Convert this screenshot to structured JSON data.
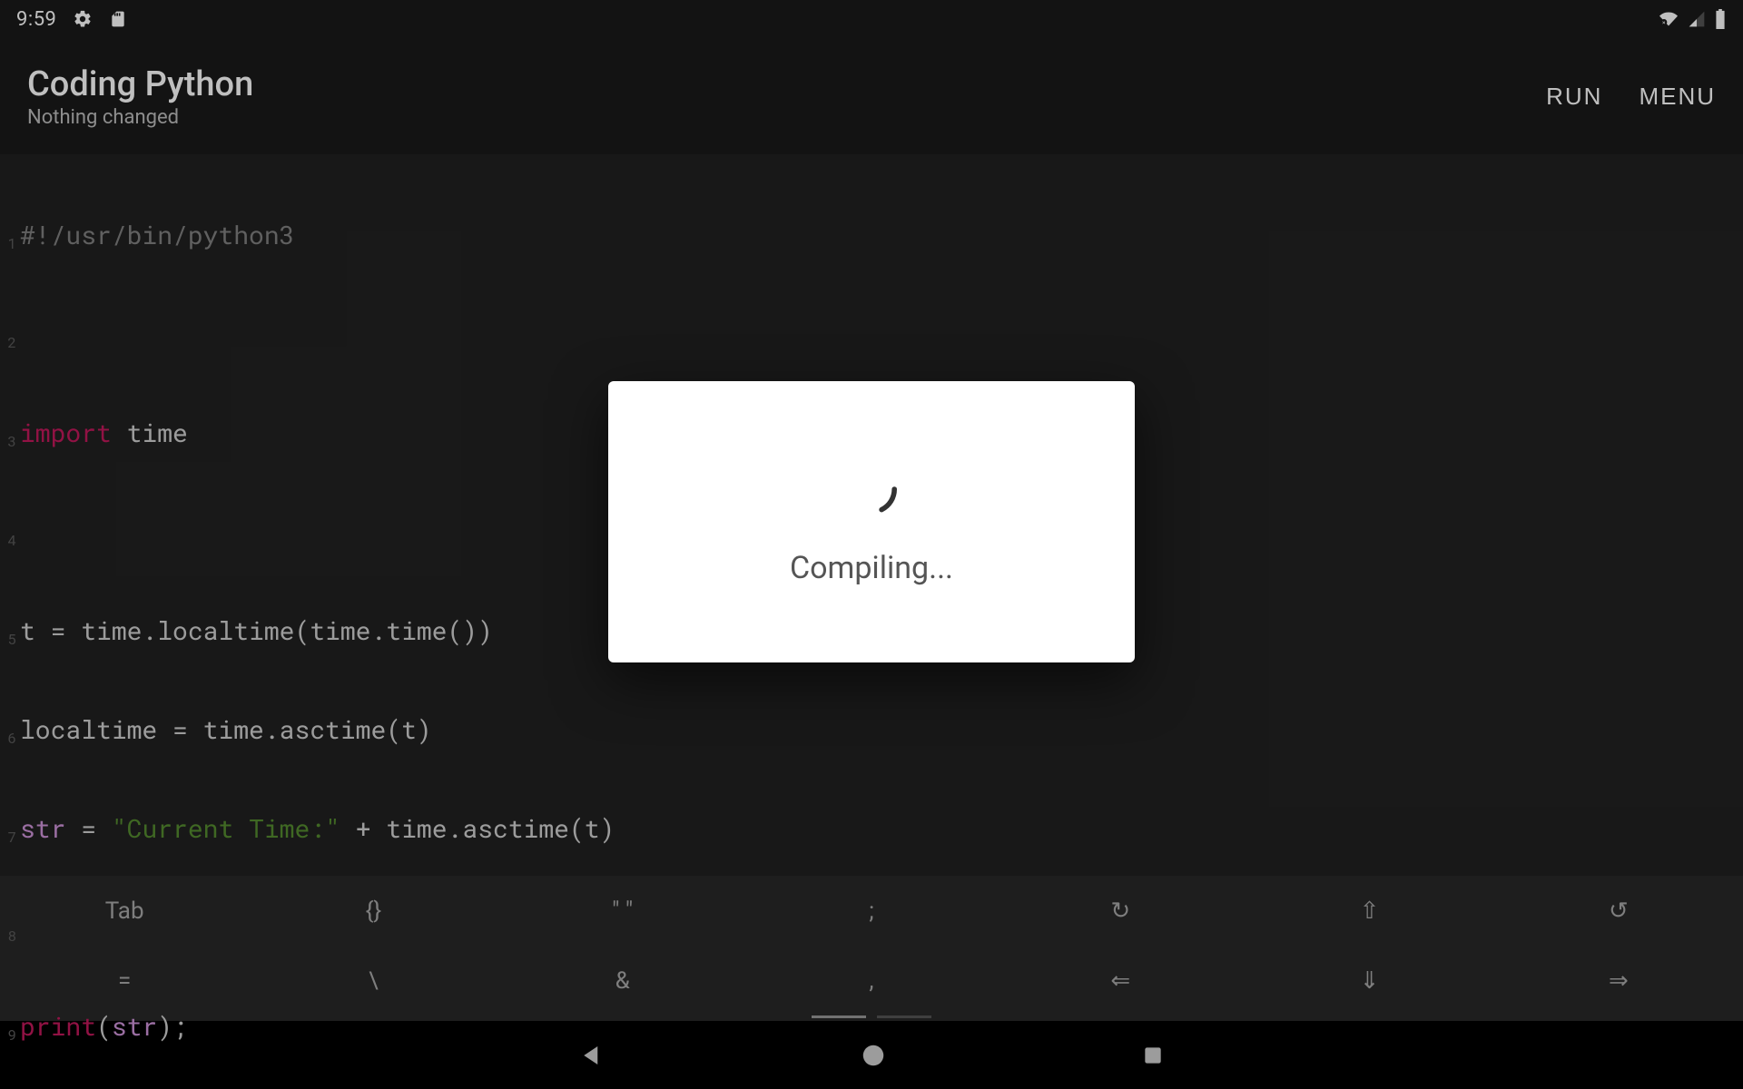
{
  "status": {
    "time": "9:59"
  },
  "toolbar": {
    "title": "Coding Python",
    "subtitle": "Nothing changed",
    "run_label": "RUN",
    "menu_label": "MENU"
  },
  "code": {
    "lines": [
      {
        "n": "1",
        "comment": "#!/usr/bin/python3"
      },
      {
        "n": "2",
        "blank": ""
      },
      {
        "n": "3",
        "kw": "import",
        "rest": " time"
      },
      {
        "n": "4",
        "blank": ""
      },
      {
        "n": "5",
        "plain": "t = time.localtime(time.time())"
      },
      {
        "n": "6",
        "plain": "localtime = time.asctime(t)"
      },
      {
        "n": "7",
        "name": "str",
        "mid": " = ",
        "str": "\"Current Time:\"",
        "rest": " + time.asctime(t)"
      },
      {
        "n": "8",
        "blank": ""
      },
      {
        "n": "9",
        "call": "print",
        "lp": "(",
        "arg": "str",
        "rp": ");"
      }
    ]
  },
  "kb": {
    "row1": [
      "Tab",
      "{}",
      "\" \"",
      ";",
      "↻",
      "⇧",
      "↺"
    ],
    "row2": [
      "=",
      "\\",
      "&",
      ",",
      "⇐",
      "⇓",
      "⇒"
    ]
  },
  "modal": {
    "text": "Compiling..."
  },
  "colors": {
    "bg": "#1a1a1a",
    "editor_bg": "#212121",
    "keyword": "#c2185b",
    "string": "#558b2f",
    "comment": "#808080",
    "name": "#ce93d8"
  }
}
